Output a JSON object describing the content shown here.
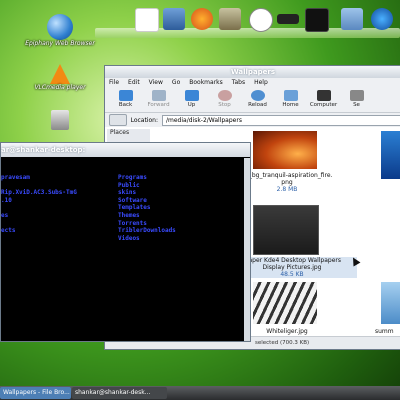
{
  "desktop": {
    "icons": [
      {
        "label": "Epiphany Web Browser",
        "icon": "epiphany-globe-icon"
      },
      {
        "label": "VLCmedia player",
        "icon": "vlc-cone-icon"
      },
      {
        "label": "",
        "icon": "trash-icon"
      }
    ]
  },
  "dock": {
    "items": [
      "document-icon",
      "photo-icon",
      "firefox-icon",
      "gimp-icon",
      "clock-icon",
      "bar-icon",
      "screen-icon",
      "folder-icon",
      "globe-icon"
    ]
  },
  "file_manager": {
    "title": "Wallpapers",
    "menu": [
      "File",
      "Edit",
      "View",
      "Go",
      "Bookmarks",
      "Tabs",
      "Help"
    ],
    "toolbar": [
      {
        "label": "Back",
        "icon": "back-arrow-icon",
        "disabled": false
      },
      {
        "label": "Forward",
        "icon": "forward-arrow-icon",
        "disabled": true
      },
      {
        "label": "Up",
        "icon": "up-arrow-icon",
        "disabled": false
      },
      {
        "label": "Stop",
        "icon": "stop-icon",
        "disabled": true
      },
      {
        "label": "Reload",
        "icon": "reload-icon",
        "disabled": false
      },
      {
        "label": "Home",
        "icon": "home-icon",
        "disabled": false
      },
      {
        "label": "Computer",
        "icon": "computer-icon",
        "disabled": false
      },
      {
        "label": "Se",
        "icon": "search-icon",
        "disabled": false
      }
    ],
    "location_label": "Location:",
    "location_value": "/media/disk-2/Wallpapers",
    "places_label": "Places",
    "files": [
      {
        "name": "ee_bg_tranquil-aspiration_fire.\npng",
        "size": "2.8 MB"
      },
      {
        "name": "lpaper Kde4 Desktop Wallpapers\nDisplay Pictures.jpg",
        "size": "48.5 KB"
      },
      {
        "name": "Whiteliger.jpg",
        "size": ""
      },
      {
        "name": "summ",
        "size": ""
      }
    ],
    "status": "selected (700.3 KB)"
  },
  "terminal": {
    "title": "ar@shankar-desktop:",
    "col1": [
      "pravesam",
      "",
      "Rip.XviD.AC3.Subs-TmG",
      ".10",
      "",
      "es",
      "",
      "ects"
    ],
    "col2": [
      "Programs",
      "Public",
      "skins",
      "Software",
      "Templates",
      "Themes",
      "Torrents",
      "TriblerDownloads",
      "Videos"
    ]
  },
  "taskbar": {
    "tasks": [
      "Wallpapers - File Bro...",
      "shankar@shankar-desk..."
    ]
  }
}
